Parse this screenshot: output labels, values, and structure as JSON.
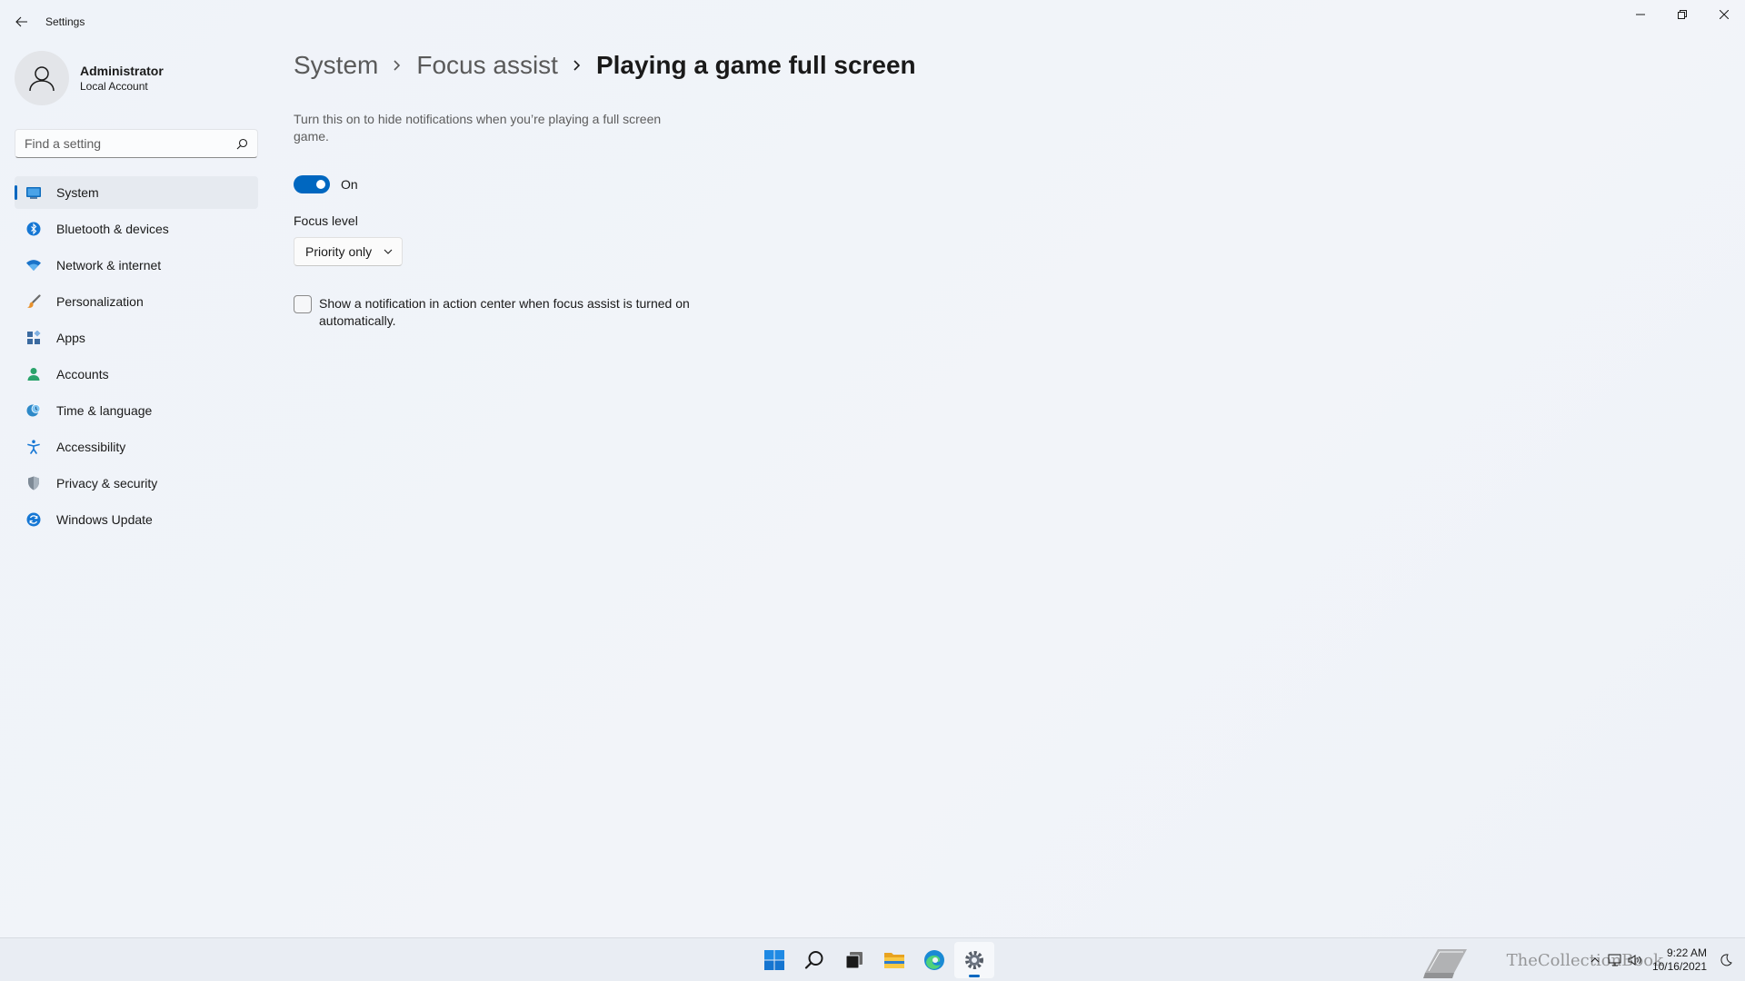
{
  "window": {
    "title": "Settings"
  },
  "profile": {
    "name": "Administrator",
    "account_type": "Local Account"
  },
  "search": {
    "placeholder": "Find a setting"
  },
  "sidebar": {
    "items": [
      {
        "label": "System",
        "icon": "system-icon",
        "selected": true
      },
      {
        "label": "Bluetooth & devices",
        "icon": "bluetooth-icon"
      },
      {
        "label": "Network & internet",
        "icon": "wifi-icon"
      },
      {
        "label": "Personalization",
        "icon": "brush-icon"
      },
      {
        "label": "Apps",
        "icon": "apps-icon"
      },
      {
        "label": "Accounts",
        "icon": "person-icon"
      },
      {
        "label": "Time & language",
        "icon": "globe-clock-icon"
      },
      {
        "label": "Accessibility",
        "icon": "accessibility-icon"
      },
      {
        "label": "Privacy & security",
        "icon": "shield-icon"
      },
      {
        "label": "Windows Update",
        "icon": "update-icon"
      }
    ]
  },
  "breadcrumb": {
    "items": [
      "System",
      "Focus assist"
    ],
    "current": "Playing a game full screen"
  },
  "content": {
    "description": "Turn this on to hide notifications when you’re playing a full screen game.",
    "toggle": {
      "state_label": "On",
      "on": true
    },
    "focus_level": {
      "label": "Focus level",
      "selected": "Priority only"
    },
    "notification_checkbox": {
      "label": "Show a notification in action center when focus assist is turned on automatically.",
      "checked": false
    }
  },
  "taskbar": {
    "apps": [
      "start-icon",
      "search-icon",
      "task-view-icon",
      "file-explorer-icon",
      "edge-icon",
      "settings-icon"
    ],
    "active_app": "settings-icon",
    "time": "9:22 AM",
    "date": "10/16/2021",
    "watermark": "TheCollectionBook"
  },
  "colors": {
    "accent": "#0067c0",
    "background": "#eff3f9"
  }
}
